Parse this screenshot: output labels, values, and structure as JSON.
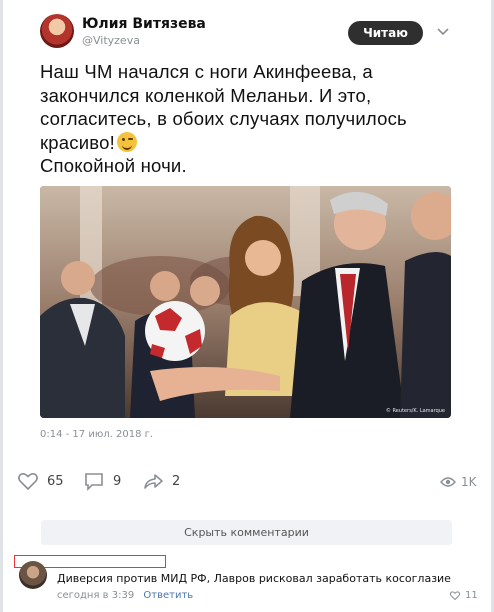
{
  "author": {
    "name": "Юлия Витязева",
    "handle": "@Vityzeva"
  },
  "follow_button_label": "Читаю",
  "tweet": {
    "lines": [
      "Наш ЧМ начался с ноги Акинфеева, а",
      "закончился коленкой Меланьи. И это,",
      "согласитесь, в обоих случаях получилось",
      "красиво!",
      "Спокойной ночи."
    ],
    "emoji": "winking-face"
  },
  "photo_caption": "© Reuters/K. Lamarque",
  "timestamp": "0:14 - 17 июл. 2018 г.",
  "actions": {
    "likes": "65",
    "comments": "9",
    "reposts": "2",
    "views": "1K"
  },
  "hide_comments_label": "Скрыть комментарии",
  "comment": {
    "text": "Диверсия против МИД РФ, Лавров рисковал заработать косоглазие",
    "time": "сегодня в 3:39",
    "reply_label": "Ответить",
    "likes": "11"
  },
  "colors": {
    "follow_button_bg": "#2f2f2f",
    "link": "#4a76a8",
    "highlight_box": "#e33333"
  }
}
